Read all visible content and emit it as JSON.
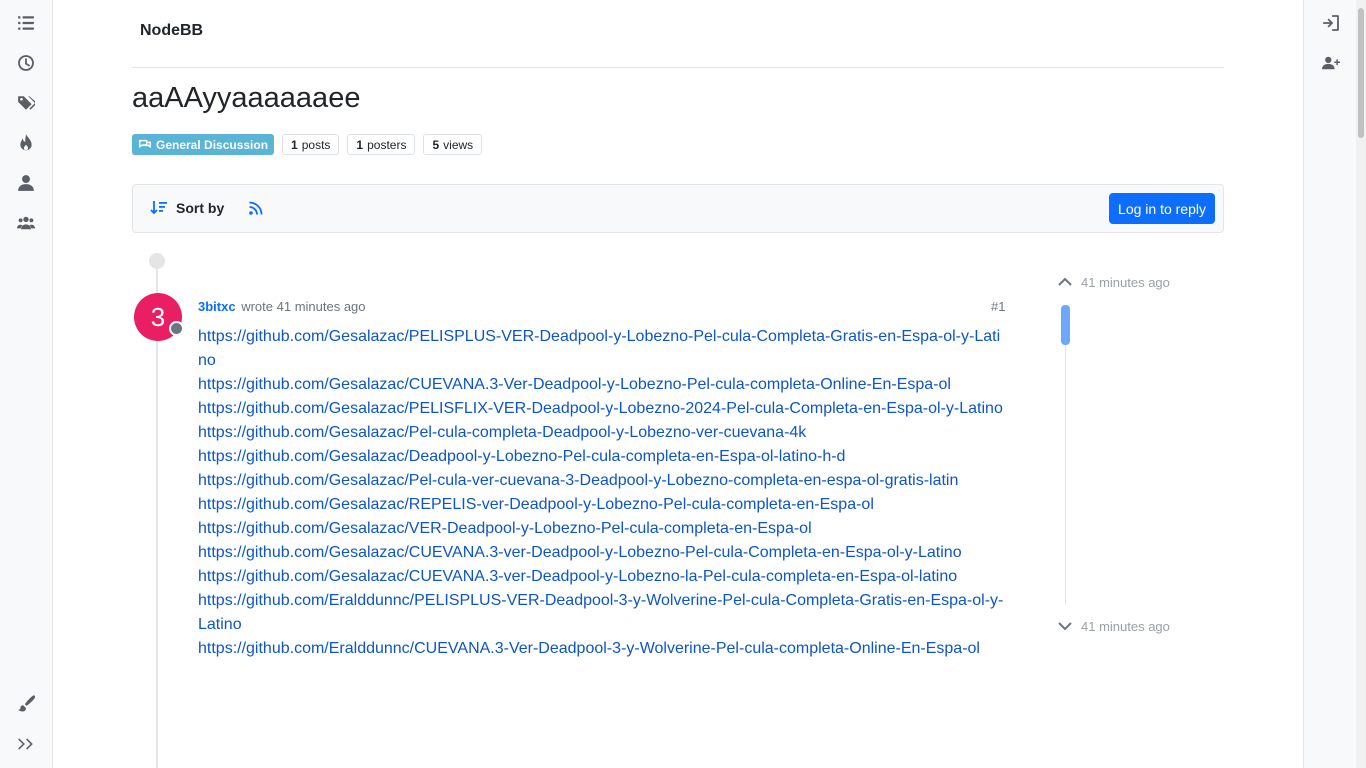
{
  "brand": {
    "name": "NodeBB"
  },
  "topic": {
    "title": "aaAAyyaaaaaaee",
    "category": "General Discussion",
    "stats": [
      {
        "count": "1",
        "label": "posts"
      },
      {
        "count": "1",
        "label": "posters"
      },
      {
        "count": "5",
        "label": "views"
      }
    ]
  },
  "toolbar": {
    "sort_label": "Sort by",
    "reply_label": "Log in to reply"
  },
  "post": {
    "avatar_letter": "3",
    "author": "3bitxc",
    "wrote": "wrote",
    "time": "41 minutes ago",
    "index": "#1",
    "links": [
      "https://github.com/Gesalazac/PELISPLUS-VER-Deadpool-y-Lobezno-Pel-cula-Completa-Gratis-en-Espa-ol-y-Latino",
      "https://github.com/Gesalazac/CUEVANA.3-Ver-Deadpool-y-Lobezno-Pel-cula-completa-Online-En-Espa-ol",
      "https://github.com/Gesalazac/PELISFLIX-VER-Deadpool-y-Lobezno-2024-Pel-cula-Completa-en-Espa-ol-y-Latino",
      "https://github.com/Gesalazac/Pel-cula-completa-Deadpool-y-Lobezno-ver-cuevana-4k",
      "https://github.com/Gesalazac/Deadpool-y-Lobezno-Pel-cula-completa-en-Espa-ol-latino-h-d",
      "https://github.com/Gesalazac/Pel-cula-ver-cuevana-3-Deadpool-y-Lobezno-completa-en-espa-ol-gratis-latin",
      "https://github.com/Gesalazac/REPELIS-ver-Deadpool-y-Lobezno-Pel-cula-completa-en-Espa-ol",
      "https://github.com/Gesalazac/VER-Deadpool-y-Lobezno-Pel-cula-completa-en-Espa-ol",
      "https://github.com/Gesalazac/CUEVANA.3-ver-Deadpool-y-Lobezno-Pel-cula-Completa-en-Espa-ol-y-Latino",
      "https://github.com/Gesalazac/CUEVANA.3-ver-Deadpool-y-Lobezno-la-Pel-cula-completa-en-Espa-ol-latino",
      "https://github.com/Eralddunnc/PELISPLUS-VER-Deadpool-3-y-Wolverine-Pel-cula-Completa-Gratis-en-Espa-ol-y-Latino",
      "https://github.com/Eralddunnc/CUEVANA.3-Ver-Deadpool-3-y-Wolverine-Pel-cula-completa-Online-En-Espa-ol"
    ]
  },
  "navigator": {
    "top_time": "41 minutes ago",
    "bottom_time": "41 minutes ago"
  },
  "colors": {
    "accent": "#0d6efd",
    "category": "#59b4d6",
    "avatar": "#e91e63"
  }
}
